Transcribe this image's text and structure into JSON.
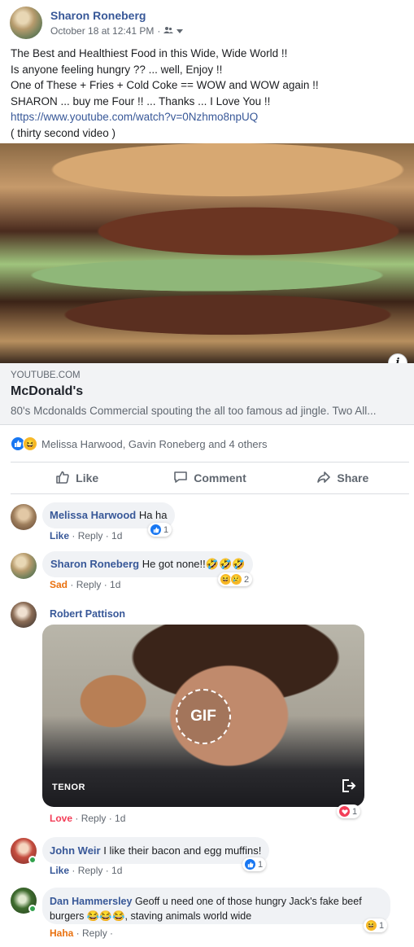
{
  "post": {
    "author": "Sharon Roneberg",
    "timestamp": "October 18 at 12:41 PM",
    "audience_icon": "friends-icon",
    "text_lines": [
      "The Best and Healthiest Food in this Wide, Wide World !!",
      "Is anyone feeling hungry ?? ... well, Enjoy !!",
      "One of These + Fries + Cold Coke == WOW and WOW again !!",
      "SHARON ... buy me Four !! ... Thanks ... I Love You !!"
    ],
    "link_text": "https://www.youtube.com/watch?v=0Nzhmo8npUQ",
    "note": "( thirty second video )"
  },
  "link_preview": {
    "domain": "YOUTUBE.COM",
    "title": "McDonald's",
    "description": "80's Mcdonalds Commercial spouting the all too famous ad jingle. Two All...",
    "info_label": "i"
  },
  "reactions": {
    "summary": "Melissa Harwood, Gavin Roneberg and 4 others"
  },
  "actions": {
    "like": "Like",
    "comment": "Comment",
    "share": "Share"
  },
  "comments": [
    {
      "name": "Melissa Harwood",
      "text": "Ha ha",
      "action": "Like",
      "reply": "Reply",
      "time": "1d",
      "reaction_count": "1"
    },
    {
      "name": "Sharon Roneberg",
      "text": "He got none!!🤣🤣🤣",
      "action": "Sad",
      "reply": "Reply",
      "time": "1d",
      "reaction_count": "2"
    },
    {
      "name": "Robert Pattison",
      "text": "",
      "action": "Love",
      "reply": "Reply",
      "time": "1d",
      "reaction_count": "1",
      "gif": {
        "badge": "GIF",
        "provider": "TENOR"
      }
    },
    {
      "name": "John Weir",
      "text": "I like their bacon and egg muffins!",
      "action": "Like",
      "reply": "Reply",
      "time": "1d",
      "reaction_count": "1"
    },
    {
      "name": "Dan Hammersley",
      "text": "Geoff u need one of those hungry Jack's fake beef burgers 😂😂😂, staving animals world wide",
      "action": "Haha",
      "reply": "Reply",
      "time": "",
      "reaction_count": "1"
    }
  ],
  "colors": {
    "link_blue": "#385898",
    "like_blue": "#1877f2",
    "haha_orange": "#e9710f",
    "love_red": "#f33e58",
    "online_green": "#31a24c"
  }
}
